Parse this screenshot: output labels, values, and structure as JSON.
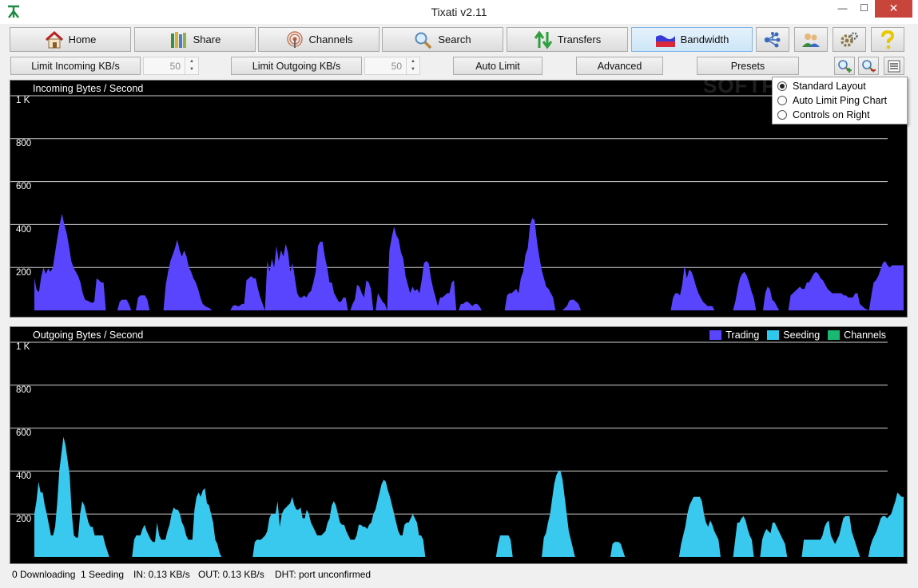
{
  "window": {
    "title": "Tixati v2.11"
  },
  "nav": {
    "home": "Home",
    "share": "Share",
    "channels": "Channels",
    "search": "Search",
    "transfers": "Transfers",
    "bandwidth": "Bandwidth"
  },
  "controls": {
    "limit_incoming": "Limit Incoming KB/s",
    "incoming_value": "50",
    "limit_outgoing": "Limit Outgoing KB/s",
    "outgoing_value": "50",
    "auto_limit": "Auto Limit",
    "advanced": "Advanced",
    "presets": "Presets"
  },
  "layout_menu": {
    "items": [
      "Standard Layout",
      "Auto Limit Ping Chart",
      "Controls on Right"
    ],
    "selected": 0
  },
  "watermark": "SOFTPEDIA",
  "chart_data": [
    {
      "type": "area",
      "title": "Incoming Bytes / Second",
      "y_tick_labels": [
        "1 K",
        "800",
        "600",
        "400",
        "200"
      ],
      "ylim": [
        0,
        1000
      ],
      "grid": true,
      "series": [
        {
          "color": "#5a45ff",
          "values": [
            150,
            95,
            85,
            160,
            200,
            170,
            195,
            180,
            200,
            270,
            340,
            400,
            450,
            400,
            360,
            300,
            230,
            200,
            180,
            160,
            130,
            80,
            50,
            45,
            40,
            35,
            40,
            150,
            140,
            130,
            130,
            0,
            0,
            0,
            0,
            0,
            0,
            40,
            50,
            50,
            50,
            30,
            0,
            0,
            0,
            60,
            70,
            70,
            70,
            50,
            0,
            0,
            0,
            0,
            0,
            0,
            0,
            120,
            180,
            230,
            260,
            290,
            330,
            280,
            250,
            280,
            250,
            200,
            180,
            150,
            130,
            100,
            60,
            30,
            20,
            15,
            10,
            0,
            0,
            0,
            0,
            0,
            0,
            0,
            0,
            0,
            20,
            25,
            20,
            20,
            30,
            30,
            140,
            150,
            160,
            150,
            150,
            100,
            60,
            30,
            0,
            230,
            180,
            240,
            200,
            300,
            230,
            280,
            250,
            310,
            270,
            180,
            220,
            150,
            80,
            60,
            60,
            70,
            60,
            80,
            90,
            130,
            180,
            300,
            320,
            320,
            250,
            200,
            130,
            130,
            80,
            60,
            40,
            40,
            60,
            60,
            0,
            0,
            30,
            50,
            120,
            110,
            80,
            60,
            140,
            130,
            100,
            0,
            0,
            80,
            60,
            40,
            30,
            0,
            280,
            340,
            390,
            350,
            330,
            270,
            240,
            160,
            120,
            80,
            110,
            90,
            100,
            80,
            140,
            220,
            230,
            220,
            150,
            100,
            60,
            20,
            60,
            60,
            70,
            80,
            80,
            130,
            140,
            0,
            0,
            30,
            30,
            40,
            40,
            30,
            20,
            30,
            30,
            20,
            0,
            0,
            0,
            0,
            0,
            0,
            0,
            0,
            0,
            0,
            0,
            70,
            80,
            80,
            90,
            100,
            80,
            150,
            180,
            260,
            290,
            400,
            430,
            420,
            320,
            250,
            190,
            150,
            110,
            100,
            80,
            60,
            0,
            0,
            0,
            0,
            10,
            20,
            45,
            50,
            50,
            40,
            30,
            0,
            0,
            0,
            0,
            0,
            0,
            0,
            0,
            0,
            0,
            0,
            0,
            0,
            0,
            0,
            0,
            0,
            0,
            0,
            0,
            0,
            0,
            0,
            0,
            0,
            0,
            0,
            0,
            0,
            0,
            0,
            0,
            0,
            0,
            0,
            0,
            0,
            0,
            0,
            0,
            60,
            80,
            80,
            70,
            120,
            210,
            150,
            190,
            180,
            150,
            110,
            80,
            60,
            40,
            30,
            20,
            20,
            20,
            0,
            0,
            0,
            0,
            0,
            0,
            0,
            0,
            0,
            40,
            100,
            150,
            170,
            180,
            160,
            130,
            90,
            60,
            0,
            0,
            0,
            0,
            80,
            110,
            100,
            50,
            40,
            20,
            0,
            0,
            0,
            0,
            0,
            70,
            80,
            90,
            100,
            110,
            100,
            100,
            130,
            130,
            150,
            170,
            180,
            170,
            150,
            140,
            120,
            100,
            90,
            80,
            80,
            80,
            80,
            80,
            70,
            70,
            60,
            60,
            60,
            80,
            80,
            30,
            20,
            10,
            5,
            0,
            70,
            130,
            140,
            160,
            190,
            220,
            230,
            210,
            200,
            210,
            210,
            210,
            210,
            210,
            210
          ]
        }
      ]
    },
    {
      "type": "area",
      "title": "Outgoing Bytes / Second",
      "y_tick_labels": [
        "1 K",
        "800",
        "600",
        "400",
        "200"
      ],
      "ylim": [
        0,
        1000
      ],
      "grid": true,
      "legend": {
        "position": "top-right",
        "entries": [
          "Trading",
          "Seeding",
          "Channels"
        ],
        "colors": [
          "#5a45ff",
          "#2ec8ec",
          "#19b873"
        ]
      },
      "series": [
        {
          "color": "#3ac9ee",
          "values": [
            200,
            260,
            350,
            300,
            300,
            240,
            200,
            150,
            100,
            100,
            140,
            250,
            400,
            480,
            560,
            520,
            450,
            380,
            200,
            100,
            90,
            90,
            200,
            260,
            240,
            200,
            160,
            140,
            140,
            100,
            100,
            100,
            100,
            100,
            60,
            30,
            0,
            0,
            0,
            0,
            0,
            0,
            0,
            0,
            0,
            0,
            0,
            0,
            80,
            100,
            100,
            100,
            130,
            150,
            120,
            100,
            80,
            70,
            70,
            160,
            100,
            80,
            80,
            80,
            120,
            150,
            200,
            230,
            220,
            220,
            200,
            160,
            140,
            100,
            80,
            80,
            80,
            220,
            280,
            300,
            280,
            310,
            320,
            250,
            240,
            200,
            160,
            80,
            60,
            20,
            0,
            0,
            0,
            0,
            0,
            0,
            0,
            0,
            0,
            0,
            0,
            0,
            0,
            0,
            0,
            0,
            70,
            80,
            80,
            80,
            90,
            100,
            120,
            180,
            200,
            200,
            200,
            260,
            140,
            200,
            220,
            230,
            240,
            250,
            280,
            240,
            220,
            220,
            230,
            180,
            180,
            220,
            200,
            160,
            140,
            120,
            100,
            100,
            100,
            110,
            120,
            160,
            180,
            240,
            260,
            240,
            200,
            160,
            150,
            150,
            120,
            100,
            80,
            80,
            80,
            100,
            150,
            150,
            140,
            140,
            130,
            150,
            160,
            200,
            220,
            260,
            300,
            340,
            360,
            350,
            310,
            280,
            240,
            200,
            160,
            120,
            100,
            100,
            150,
            160,
            160,
            180,
            200,
            180,
            160,
            100,
            100,
            80,
            0,
            0,
            0,
            0,
            0,
            0,
            0,
            0,
            0,
            0,
            0,
            0,
            0,
            0,
            0,
            0,
            0,
            0,
            0,
            0,
            0,
            0,
            0,
            0,
            0,
            0,
            0,
            0,
            0,
            0,
            0,
            0,
            0,
            0,
            0,
            60,
            100,
            100,
            100,
            100,
            100,
            80,
            0,
            0,
            0,
            0,
            0,
            0,
            0,
            0,
            0,
            0,
            0,
            0,
            0,
            0,
            0,
            90,
            110,
            160,
            200,
            270,
            340,
            380,
            400,
            400,
            360,
            280,
            200,
            120,
            80,
            40,
            0,
            0,
            0,
            0,
            0,
            0,
            0,
            0,
            0,
            0,
            0,
            0,
            0,
            0,
            0,
            0,
            0,
            0,
            60,
            70,
            70,
            70,
            60,
            30,
            0,
            0,
            0,
            0,
            0,
            0,
            0,
            0,
            0,
            0,
            0,
            0,
            0,
            0,
            0,
            0,
            0,
            0,
            0,
            0,
            0,
            0,
            0,
            0,
            0,
            0,
            0,
            60,
            100,
            140,
            200,
            240,
            260,
            280,
            280,
            280,
            280,
            260,
            200,
            160,
            140,
            170,
            150,
            120,
            100,
            80,
            0,
            0,
            0,
            0,
            0,
            0,
            0,
            80,
            160,
            160,
            180,
            190,
            170,
            130,
            100,
            80,
            0,
            0,
            0,
            0,
            80,
            110,
            130,
            120,
            110,
            160,
            160,
            140,
            120,
            100,
            80,
            60,
            0,
            0,
            0,
            0,
            0,
            0,
            0,
            0,
            80,
            80,
            80,
            80,
            80,
            80,
            80,
            80,
            80,
            100,
            140,
            160,
            170,
            100,
            80,
            60,
            80,
            100,
            140,
            180,
            190,
            190,
            190,
            120,
            90,
            60,
            30,
            0,
            0,
            0,
            0,
            0,
            50,
            80,
            100,
            120,
            150,
            180,
            190,
            190,
            180,
            190,
            200,
            230,
            260,
            300,
            290,
            280,
            280
          ]
        }
      ]
    }
  ],
  "status": {
    "downloading": "0 Downloading",
    "seeding": "1 Seeding",
    "in": "IN: 0.13 KB/s",
    "out": "OUT: 0.13 KB/s",
    "dht": "DHT: port unconfirmed"
  }
}
